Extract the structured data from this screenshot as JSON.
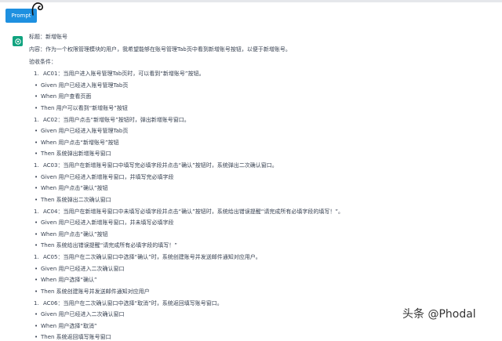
{
  "toolbar": {
    "prompt_label": "Prompt"
  },
  "message": {
    "title": "标题：新增账号",
    "intro": "内容：作为一个权限管理模块的用户，我希望能够在账号管理Tab页中看到新增账号按钮，以便于新增账号。",
    "criteria_label": "验收条件：",
    "criteria": [
      {
        "number": "1.",
        "text": "AC01：当用户进入账号管理Tab页时，可以看到“新增账号”按钮。",
        "given": "Given 用户已经进入账号管理Tab页",
        "when": "When 用户查看页面",
        "then": "Then 用户可以看到“新增账号”按钮"
      },
      {
        "number": "1.",
        "text": "AC02：当用户点击“新增账号”按钮时，弹出新增账号窗口。",
        "given": "Given 用户已经进入账号管理Tab页",
        "when": "When 用户点击“新增账号”按钮",
        "then": "Then 系统弹出新增账号窗口"
      },
      {
        "number": "1.",
        "text": "AC03：当用户在新增账号窗口中填写完必填字段并点击“确认”按钮时，系统弹出二次确认窗口。",
        "given": "Given 用户已经进入新增账号窗口，并填写完必填字段",
        "when": "When 用户点击“确认”按钮",
        "then": "Then 系统弹出二次确认窗口"
      },
      {
        "number": "1.",
        "text": "AC04：当用户在新增账号窗口中未填写必填字段并点击“确认”按钮时，系统给出错误提醒“请完成所有必填字段的填写！”。",
        "given": "Given 用户已经进入新增账号窗口，并未填写必填字段",
        "when": "When 用户点击“确认”按钮",
        "then": "Then 系统给出错误提醒“请完成所有必填字段的填写！”"
      },
      {
        "number": "1.",
        "text": "AC05：当用户在二次确认窗口中选择“确认”时，系统创建账号并发送邮件通知对应用户。",
        "given": "Given 用户已经进入二次确认窗口",
        "when": "When 用户选择“确认”",
        "then": "Then 系统创建账号并发送邮件通知对应用户"
      },
      {
        "number": "1.",
        "text": "AC06：当用户在二次确认窗口中选择“取消”时，系统返回填写账号窗口。",
        "given": "Given 用户已经进入二次确认窗口",
        "when": "When 用户选择“取消”",
        "then": "Then 系统返回填写账号窗口"
      }
    ]
  },
  "watermark": "头条 @Phodal",
  "icons": {
    "avatar": "openai-logo-icon",
    "cursor": "hand-cursor-icon"
  },
  "colors": {
    "prompt_button": "#1e90e0",
    "avatar": "#10a37f"
  }
}
